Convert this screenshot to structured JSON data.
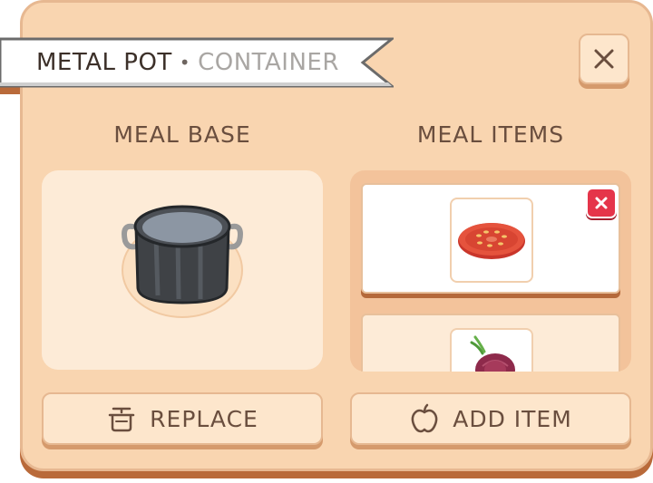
{
  "header": {
    "title": "METAL POT",
    "separator": "•",
    "subtitle": "CONTAINER",
    "close_icon": "close-icon"
  },
  "meal_base": {
    "heading": "MEAL BASE",
    "image_icon": "metal-pot-icon",
    "replace_label": "REPLACE",
    "replace_icon": "pot-icon"
  },
  "meal_items": {
    "heading": "MEAL ITEMS",
    "items": [
      {
        "icon": "tomato-slice-icon",
        "remove_icon": "remove-icon"
      },
      {
        "icon": "red-onion-icon"
      }
    ],
    "add_label": "ADD ITEM",
    "add_icon": "apple-icon"
  },
  "colors": {
    "panel": "#f9d5b0",
    "panel_shadow": "#b96a3a",
    "text": "#6a4e3e",
    "remove": "#e5354a"
  }
}
